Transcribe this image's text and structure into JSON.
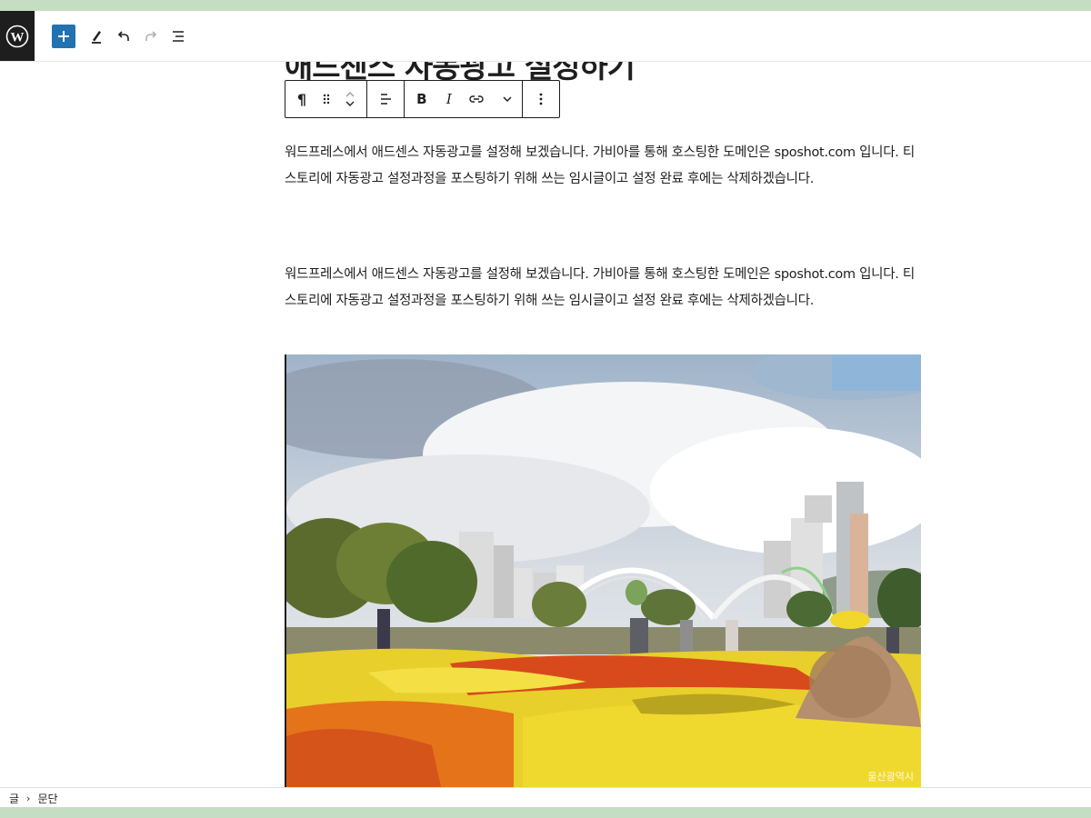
{
  "post": {
    "title": "애드센스 자동광고 설정하기",
    "paragraphs": [
      "워드프레스에서 애드센스 자동광고를 설정해 보겠습니다. 가비아를 통해 호스팅한 도메인은 sposhot.com 입니다. 티스토리에 자동광고 설정과정을 포스팅하기 위해 쓰는 임시글이고 설정 완료 후에는 삭제하겠습니다.",
      "워드프레스에서 애드센스 자동광고를 설정해 보겠습니다. 가비아를 통해 호스팅한 도메인은 sposhot.com 입니다. 티스토리에 자동광고 설정과정을 포스팅하기 위해 쓰는 임시글이고 설정 완료 후에는 삭제하겠습니다."
    ],
    "image_watermark": "울산광역시"
  },
  "block_toolbar": {
    "bold_label": "B",
    "italic_label": "I",
    "paragraph_symbol": "¶"
  },
  "breadcrumb": {
    "items": [
      "글",
      "문단"
    ],
    "separator": "›"
  },
  "icons": {
    "logo": "wordpress-logo",
    "add": "plus-icon",
    "tools": "pencil-icon",
    "undo": "undo-icon",
    "redo": "redo-icon",
    "list_view": "list-view-icon"
  },
  "colors": {
    "accent": "#2271b1",
    "dark": "#1e1e1e",
    "page_bg": "#c5dec3"
  }
}
